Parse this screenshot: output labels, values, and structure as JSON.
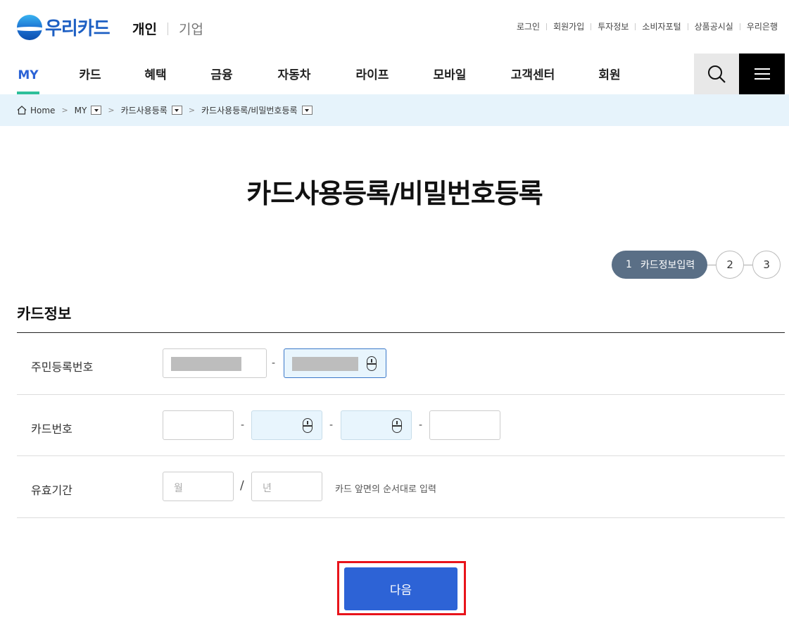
{
  "brand": {
    "name": "우리카드",
    "color": "#1d5fc3"
  },
  "mode_tabs": [
    {
      "label": "개인",
      "active": true
    },
    {
      "label": "기업",
      "active": false
    }
  ],
  "util_links": [
    "로그인",
    "회원가입",
    "투자정보",
    "소비자포털",
    "상품공시실",
    "우리은행"
  ],
  "gnb": [
    {
      "label": "MY",
      "active": true
    },
    {
      "label": "카드"
    },
    {
      "label": "혜택"
    },
    {
      "label": "금융"
    },
    {
      "label": "자동차"
    },
    {
      "label": "라이프"
    },
    {
      "label": "모바일"
    },
    {
      "label": "고객센터"
    },
    {
      "label": "회원"
    }
  ],
  "icons": {
    "search": "search-icon",
    "menu": "hamburger-menu-icon",
    "home": "home-icon"
  },
  "breadcrumb": [
    "Home",
    "MY",
    "카드사용등록",
    "카드사용등록/비밀번호등록"
  ],
  "page_title": "카드사용등록/비밀번호등록",
  "steps": [
    {
      "num": "1",
      "label": "카드정보입력",
      "active": true
    },
    {
      "num": "2"
    },
    {
      "num": "3"
    }
  ],
  "section_title": "카드정보",
  "form": {
    "rrn_label": "주민등록번호",
    "card_label": "카드번호",
    "expiry_label": "유효기간",
    "separator": "-",
    "slash": "/",
    "month_placeholder": "월",
    "year_placeholder": "년",
    "expiry_hint": "카드 앞면의 순서대로 입력"
  },
  "next_button": "다음",
  "colors": {
    "accent": "#2d63d6",
    "active_underline": "#2dbf9b",
    "step_active": "#5a6f86",
    "highlight": "#e8141b"
  }
}
